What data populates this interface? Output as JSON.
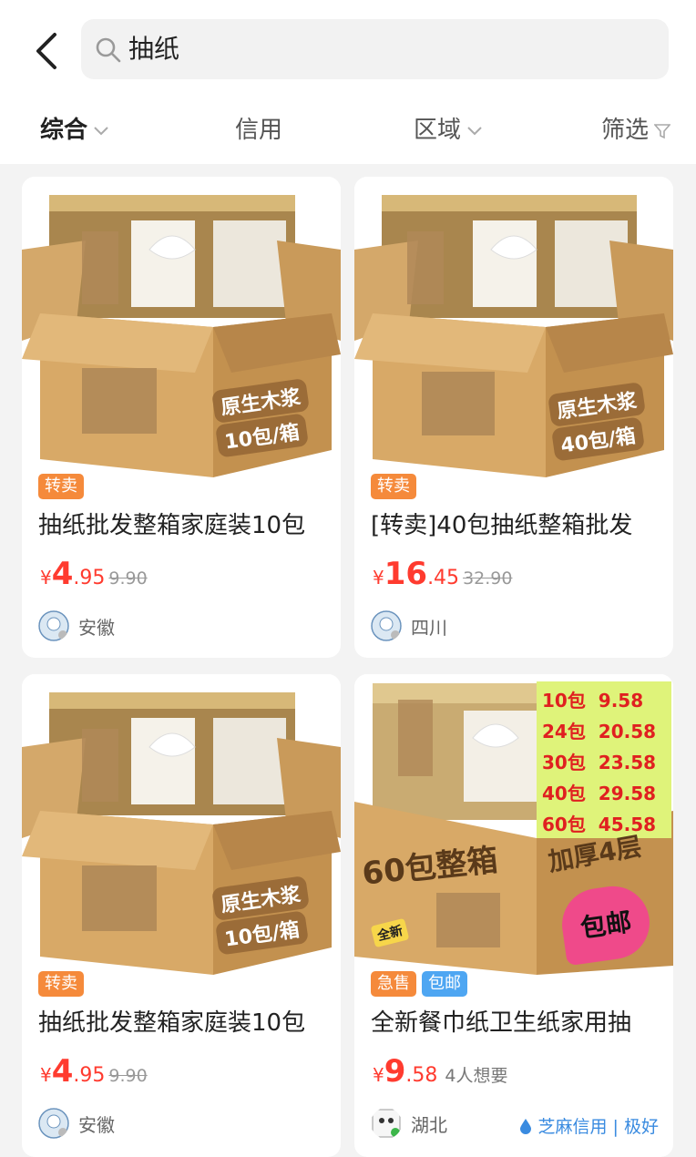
{
  "search": {
    "query": "抽纸"
  },
  "filters": [
    {
      "label": "综合"
    },
    {
      "label": "信用"
    },
    {
      "label": "区域"
    },
    {
      "label": "筛选"
    }
  ],
  "products": [
    {
      "box_label1": "原生木浆",
      "box_label2": "10包/箱",
      "tags": [
        "转卖"
      ],
      "title": "抽纸批发整箱家庭装10包",
      "price_symbol": "¥",
      "price_int": "4",
      "price_dec": ".95",
      "orig_price": "9.90",
      "location": "安徽"
    },
    {
      "box_label1": "原生木浆",
      "box_label2": "40包/箱",
      "tags": [
        "转卖"
      ],
      "title": "[转卖]40包抽纸整箱批发",
      "price_symbol": "¥",
      "price_int": "16",
      "price_dec": ".45",
      "orig_price": "32.90",
      "location": "四川"
    },
    {
      "box_label1": "原生木浆",
      "box_label2": "10包/箱",
      "tags": [
        "转卖"
      ],
      "title": "抽纸批发整箱家庭装10包",
      "price_symbol": "¥",
      "price_int": "4",
      "price_dec": ".95",
      "orig_price": "9.90",
      "location": "安徽"
    },
    {
      "box_label1": "60包整箱",
      "box_label2": "加厚4层",
      "sticker": "包邮",
      "new_badge": "全新",
      "price_list": [
        {
          "qty": "10包",
          "price": "9.58"
        },
        {
          "qty": "24包",
          "price": "20.58"
        },
        {
          "qty": "30包",
          "price": "23.58"
        },
        {
          "qty": "40包",
          "price": "29.58"
        },
        {
          "qty": "60包",
          "price": "45.58"
        }
      ],
      "tags": [
        "急售",
        "包邮"
      ],
      "title": "全新餐巾纸卫生纸家用抽",
      "price_symbol": "¥",
      "price_int": "9",
      "price_dec": ".58",
      "want": "4人想要",
      "location": "湖北",
      "credit": "芝麻信用 | 极好"
    }
  ],
  "colors": {
    "price_red": "#ff3b2f",
    "tag_orange": "#f58a3b",
    "tag_blue": "#4ea6f2",
    "credit_blue": "#3a8be0",
    "price_list_bg": "#dff37a"
  }
}
